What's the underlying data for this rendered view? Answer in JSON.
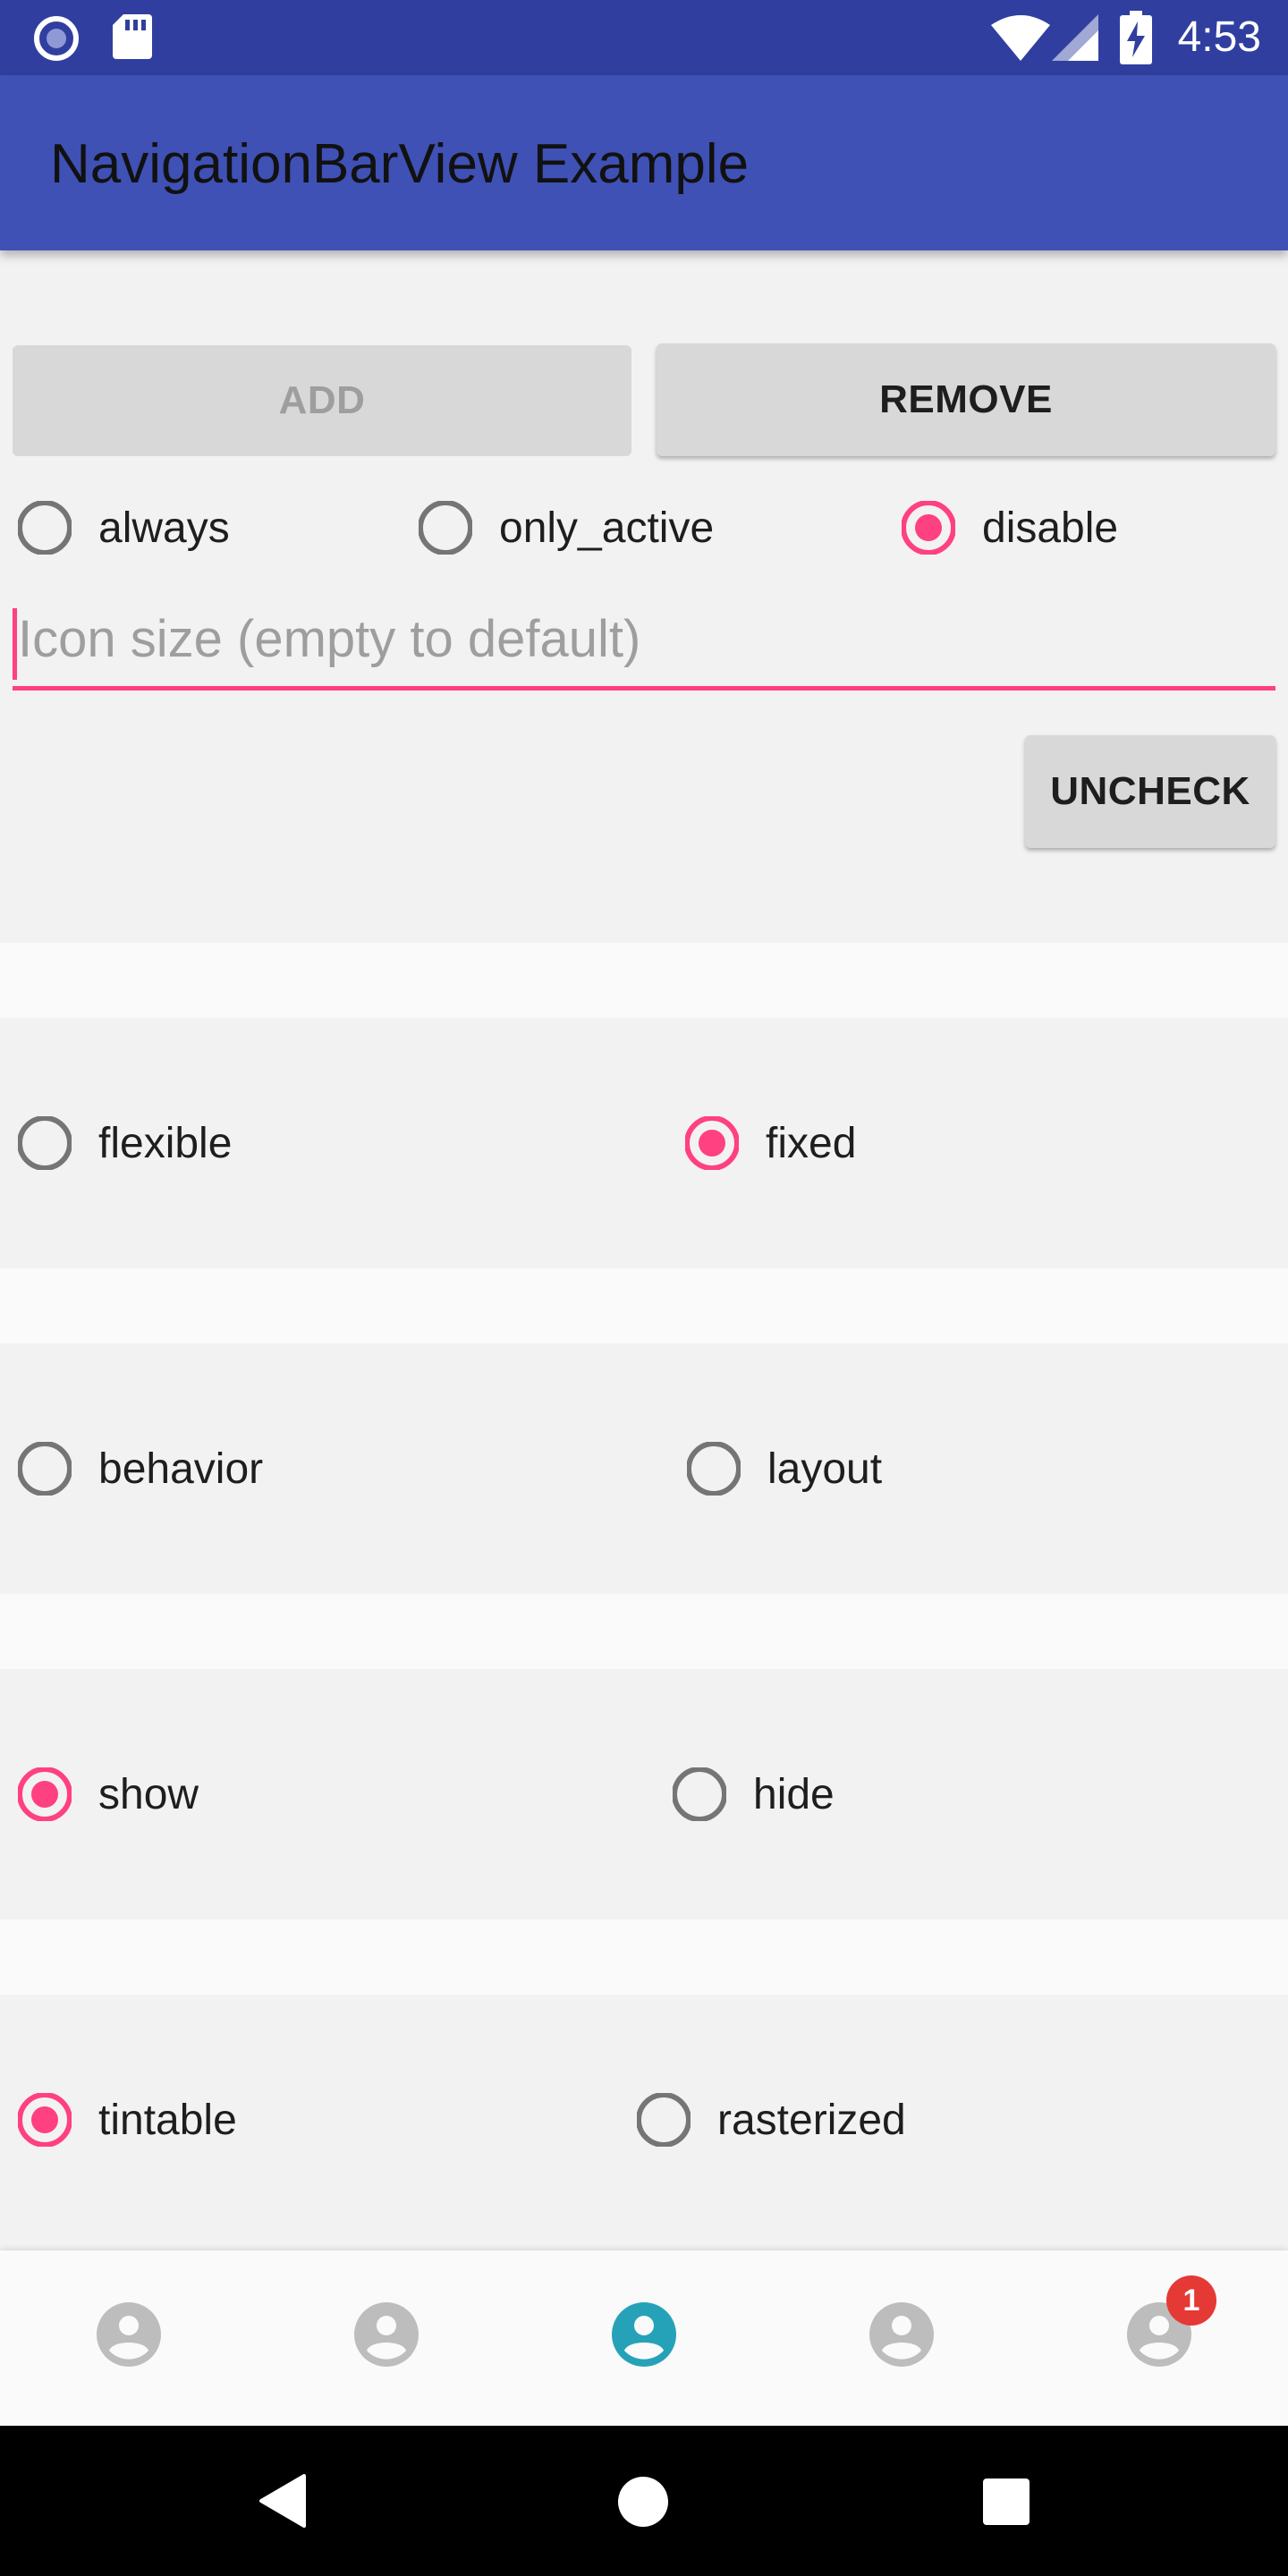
{
  "status_bar": {
    "time": "4:53",
    "icons": [
      "app-circle-icon",
      "sd-card-icon",
      "wifi-icon",
      "cell-signal-icon",
      "battery-charging-icon"
    ]
  },
  "app_bar": {
    "title": "NavigationBarView Example"
  },
  "buttons": {
    "add_label": "ADD",
    "remove_label": "REMOVE",
    "uncheck_label": "UNCHECK"
  },
  "label_mode": {
    "options": [
      {
        "label": "always",
        "checked": false
      },
      {
        "label": "only_active",
        "checked": false
      },
      {
        "label": "disable",
        "checked": true
      }
    ]
  },
  "icon_size": {
    "value": "",
    "placeholder": "Icon size (empty to default)"
  },
  "option_groups": [
    {
      "options": [
        {
          "label": "flexible",
          "checked": false
        },
        {
          "label": "fixed",
          "checked": true
        }
      ]
    },
    {
      "options": [
        {
          "label": "behavior",
          "checked": false
        },
        {
          "label": "layout",
          "checked": false
        }
      ]
    },
    {
      "options": [
        {
          "label": "show",
          "checked": true
        },
        {
          "label": "hide",
          "checked": false
        }
      ]
    },
    {
      "options": [
        {
          "label": "tintable",
          "checked": true
        },
        {
          "label": "rasterized",
          "checked": false
        }
      ]
    }
  ],
  "bottom_nav": {
    "items": [
      {
        "icon": "account-circle-icon",
        "active": false
      },
      {
        "icon": "account-circle-icon",
        "active": false
      },
      {
        "icon": "account-circle-icon",
        "active": true
      },
      {
        "icon": "account-circle-icon",
        "active": false
      },
      {
        "icon": "account-circle-icon",
        "active": false,
        "badge": "1"
      }
    ]
  },
  "colors": {
    "status_bar": "#303f9f",
    "app_bar": "#3f51b5",
    "accent": "#ff4081",
    "nav_active": "#26a2b8",
    "nav_inactive": "#bdbdbd",
    "badge": "#e53935"
  }
}
